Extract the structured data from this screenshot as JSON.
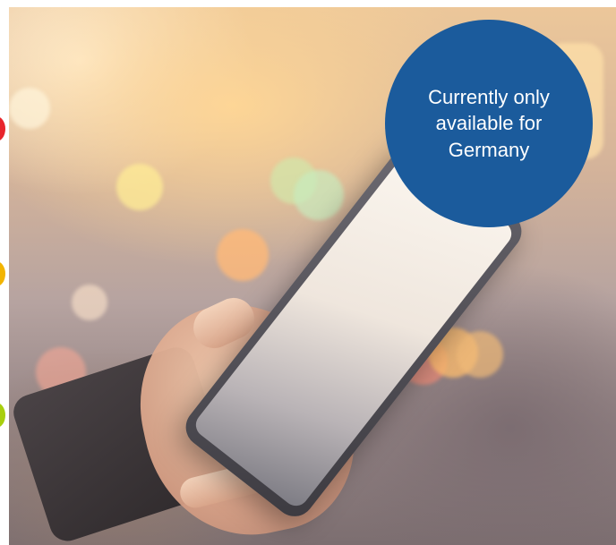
{
  "banner": {
    "badge_text": "Currently only\navailable for\nGermany",
    "badge_color": "#1b5b9c"
  },
  "photo": {
    "subject": "hand holding smartphone with bokeh lights"
  },
  "edge_dots": [
    {
      "color": "#e8252c"
    },
    {
      "color": "#f2b400"
    },
    {
      "color": "#a8cf0e"
    }
  ]
}
